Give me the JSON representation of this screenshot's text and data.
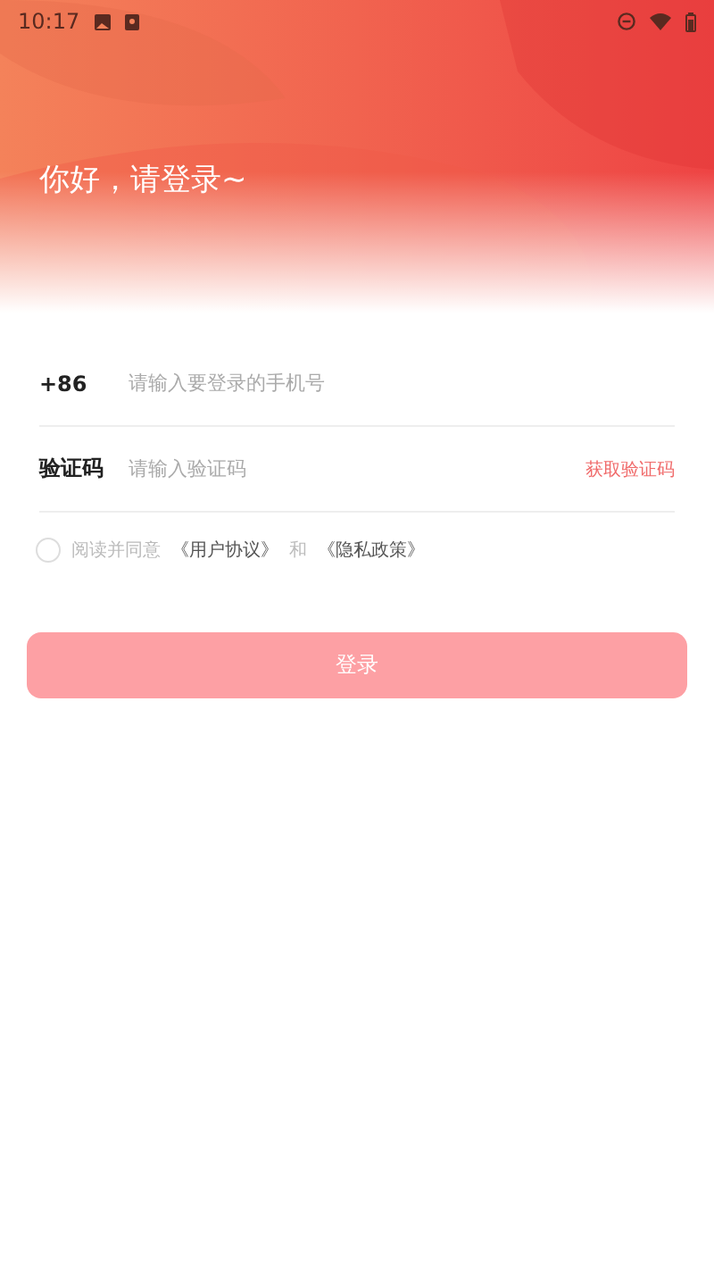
{
  "status_bar": {
    "time": "10:17"
  },
  "greeting": "你好，请登录~",
  "fields": [
    {
      "label": "+86",
      "placeholder": "请输入要登录的手机号"
    },
    {
      "label": "验证码",
      "placeholder": "请输入验证码",
      "action": "获取验证码"
    }
  ],
  "agreement": {
    "checked": false,
    "prefix": "阅读并同意",
    "link_1": "《用户协议》",
    "joiner": "和",
    "link_2": "《隐私政策》"
  },
  "login_button": {
    "label": "登录",
    "disabled": true
  }
}
